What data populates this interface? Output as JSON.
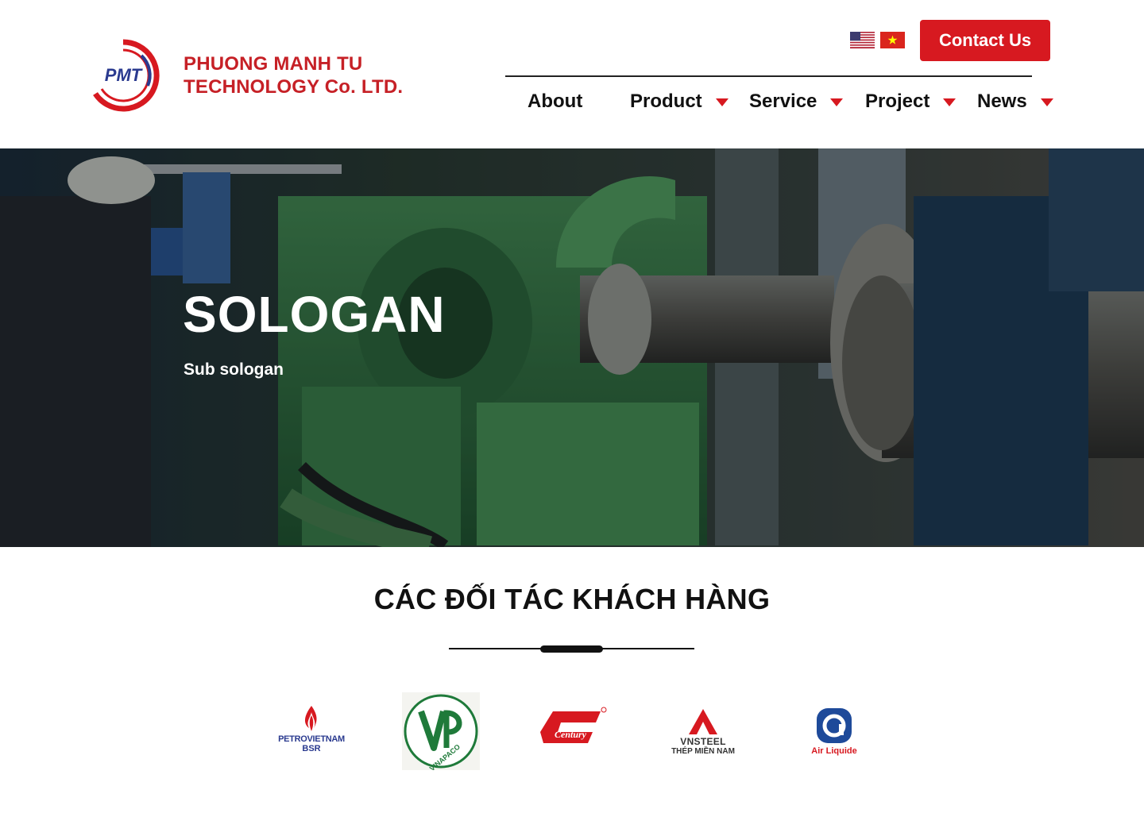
{
  "header": {
    "company_line1": "PHUONG MANH TU",
    "company_line2": "TECHNOLOGY Co. LTD.",
    "logo_text": "PMT",
    "contact_label": "Contact Us",
    "languages": [
      {
        "name": "us-flag-icon",
        "code": "en"
      },
      {
        "name": "vn-flag-icon",
        "code": "vi"
      }
    ]
  },
  "nav": {
    "items": [
      {
        "label": "About",
        "has_dropdown": false
      },
      {
        "label": "Product",
        "has_dropdown": true
      },
      {
        "label": "Service",
        "has_dropdown": true
      },
      {
        "label": "Project",
        "has_dropdown": true
      },
      {
        "label": "News",
        "has_dropdown": true
      }
    ]
  },
  "hero": {
    "title": "SOLOGAN",
    "subtitle": "Sub sologan"
  },
  "partners": {
    "title": "CÁC ĐỐI TÁC KHÁCH HÀNG",
    "logos": [
      {
        "name": "petrovietnam-bsr-logo",
        "line1": "PETROVIETNAM",
        "line2": "BSR"
      },
      {
        "name": "vinapaco-logo",
        "text": "VINAPACO"
      },
      {
        "name": "century-logo",
        "text": "Century"
      },
      {
        "name": "vnsteel-logo",
        "line1": "VNSTEEL",
        "line2": "THÉP MIỀN NAM"
      },
      {
        "name": "air-liquide-logo",
        "text": "Air Liquide"
      }
    ]
  },
  "colors": {
    "brand_red": "#d71920",
    "logo_blue": "#2a3a8f",
    "text_dark": "#111111"
  }
}
